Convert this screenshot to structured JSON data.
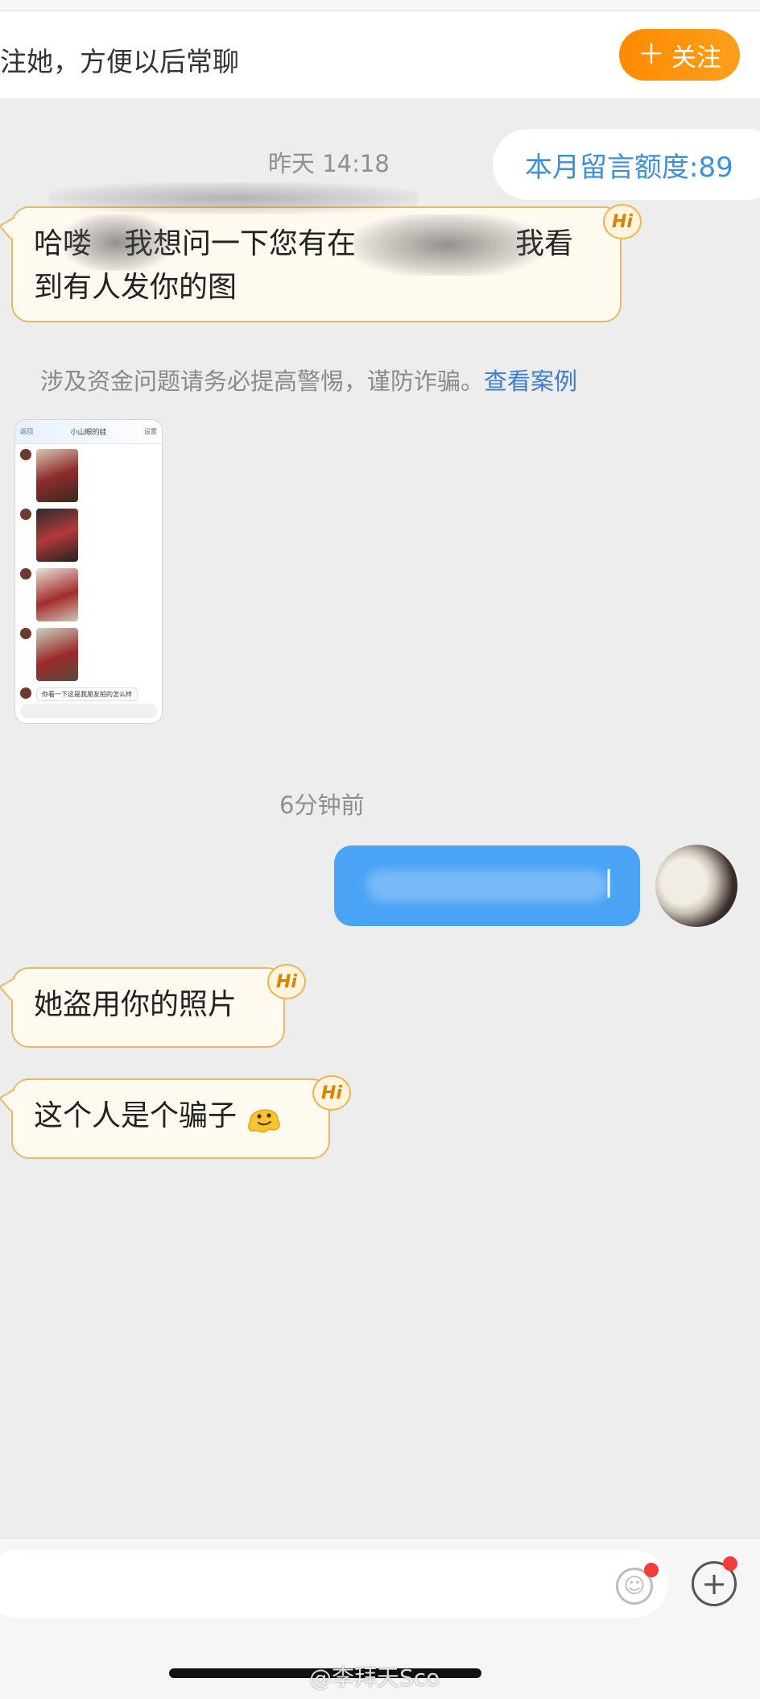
{
  "header": {
    "banner_text": "注她，方便以后常聊",
    "follow_button": "关注",
    "follow_icon": "plus-icon",
    "accent_color": "#ff9100"
  },
  "quota": {
    "text": "本月留言额度:89"
  },
  "timestamps": [
    "昨天 14:18",
    "6分钟前"
  ],
  "messages": {
    "m1_line1_start": "哈喽",
    "m1_line1_mid": "我想问一下您有在",
    "m1_line1_end": "我看",
    "m1_line2": "到有人发你的图",
    "m2": "她盗用你的照片",
    "m3": "这个人是个骗子",
    "hi_badge": "Hi"
  },
  "warning": {
    "text": "涉及资金问题请务必提高警惕，谨防诈骗。",
    "link": "查看案例"
  },
  "thumbnail": {
    "title": "小山眼的娃",
    "back": "返回",
    "settings": "设置",
    "last_message": "你看一下这是我朋友拍的怎么样"
  },
  "outgoing": {
    "visible_char": "|"
  },
  "input_bar": {
    "emoji_icon": "emoji-icon",
    "plus_icon": "plus-icon"
  },
  "watermark": "@李拜天Sco"
}
